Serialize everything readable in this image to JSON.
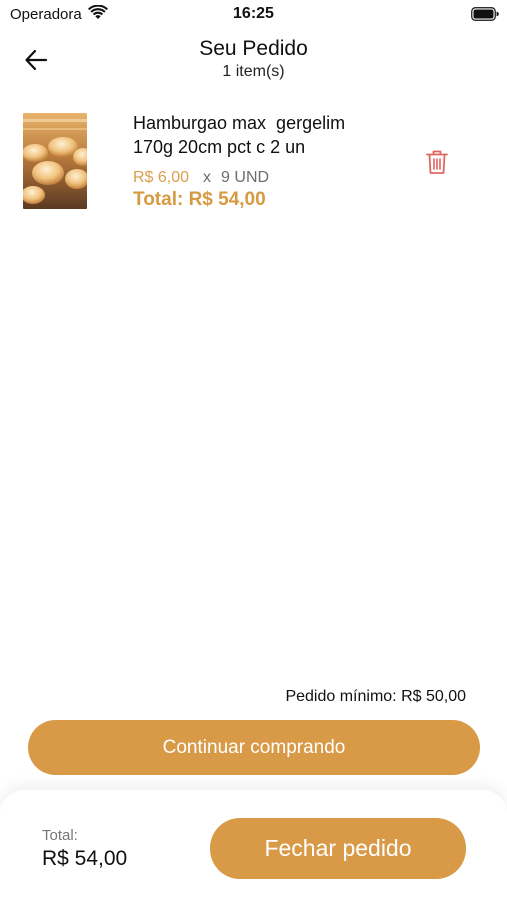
{
  "status_bar": {
    "carrier": "Operadora",
    "time": "16:25",
    "wifi_icon": "wifi-icon",
    "battery_icon": "battery-icon"
  },
  "header": {
    "back_icon": "arrow-left-icon",
    "title": "Seu Pedido",
    "subtitle": "1 item(s)"
  },
  "cart": {
    "items": [
      {
        "name": "Hamburgao max  gergelim\n170g 20cm pct c 2 un",
        "unit_price": "R$ 6,00",
        "times": "x",
        "quantity": "9 UND",
        "total": "Total: R$ 54,00",
        "image_icon": "bread-rolls-photo",
        "delete_icon": "trash-icon"
      }
    ]
  },
  "minimum_order": "Pedido mínimo: R$ 50,00",
  "continue_button": "Continuar comprando",
  "footer": {
    "total_label": "Total:",
    "total_value": "R$ 54,00",
    "checkout_button": "Fechar pedido"
  },
  "colors": {
    "accent": "#d99a48",
    "price_accent": "#d79a41",
    "delete": "#e0675f"
  }
}
